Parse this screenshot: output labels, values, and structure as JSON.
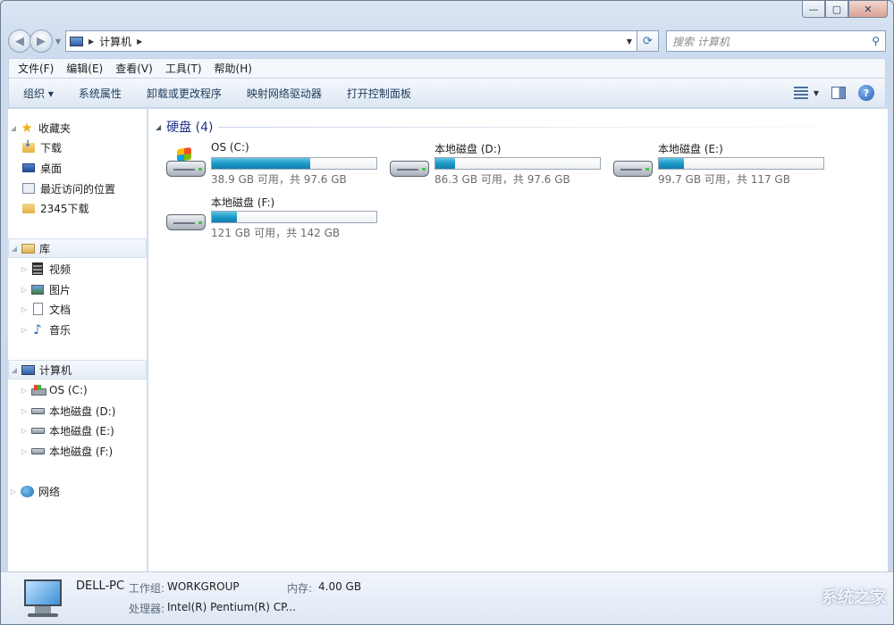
{
  "window": {
    "caption": {
      "minimize": "—",
      "maximize": "▢",
      "close": "✕"
    }
  },
  "nav": {
    "back_icon": "back-arrow-icon",
    "forward_icon": "forward-arrow-icon",
    "breadcrumb": [
      "计算机"
    ],
    "search_placeholder": "搜索 计算机"
  },
  "menubar": [
    "文件(F)",
    "编辑(E)",
    "查看(V)",
    "工具(T)",
    "帮助(H)"
  ],
  "commandbar": {
    "organize": "组织 ▾",
    "items": [
      "系统属性",
      "卸载或更改程序",
      "映射网络驱动器",
      "打开控制面板"
    ]
  },
  "navpane": {
    "favorites": {
      "label": "收藏夹",
      "items": [
        "下载",
        "桌面",
        "最近访问的位置",
        "2345下载"
      ]
    },
    "libraries": {
      "label": "库",
      "items": [
        "视频",
        "图片",
        "文档",
        "音乐"
      ]
    },
    "computer": {
      "label": "计算机",
      "items": [
        "OS (C:)",
        "本地磁盘 (D:)",
        "本地磁盘 (E:)",
        "本地磁盘 (F:)"
      ]
    },
    "network": {
      "label": "网络"
    }
  },
  "content": {
    "group_title": "硬盘 (4)",
    "drives": [
      {
        "name": "OS (C:)",
        "free": "38.9 GB 可用，共 97.6 GB",
        "used_fraction": 0.6,
        "system": true
      },
      {
        "name": "本地磁盘 (D:)",
        "free": "86.3 GB 可用，共 97.6 GB",
        "used_fraction": 0.12,
        "system": false
      },
      {
        "name": "本地磁盘 (E:)",
        "free": "99.7 GB 可用，共 117 GB",
        "used_fraction": 0.15,
        "system": false
      },
      {
        "name": "本地磁盘 (F:)",
        "free": "121 GB 可用，共 142 GB",
        "used_fraction": 0.15,
        "system": false
      }
    ]
  },
  "details": {
    "computer_name": "DELL-PC",
    "workgroup_label": "工作组:",
    "workgroup_value": "WORKGROUP",
    "memory_label": "内存:",
    "memory_value": "4.00 GB",
    "processor_label": "处理器:",
    "processor_value": "Intel(R) Pentium(R) CP...",
    "watermark": "系统之家"
  },
  "colors": {
    "accent": "#1e3287",
    "bar_fill": "#1c9ac8"
  }
}
